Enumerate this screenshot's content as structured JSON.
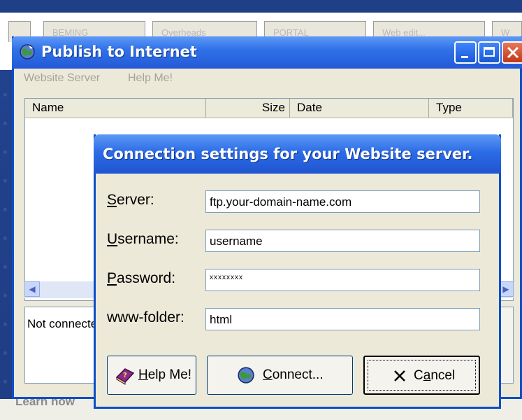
{
  "background": {
    "tabs": [
      "BEMING",
      "Overheads",
      "PORTAL",
      "Web edit...",
      "W"
    ],
    "bottom_text": "Learn how"
  },
  "window": {
    "title": "Publish to Internet",
    "menu": [
      "Website Server",
      "Help Me!"
    ],
    "columns": [
      "Name",
      "Size",
      "Date",
      "Type"
    ],
    "status": "Not connected"
  },
  "dialog": {
    "title": "Connection settings for your Website server.",
    "fields": [
      {
        "label_u": "S",
        "label_rest": "erver:",
        "value": "ftp.your-domain-name.com"
      },
      {
        "label_u": "U",
        "label_rest": "sername:",
        "value": "username"
      },
      {
        "label_u": "P",
        "label_rest": "assword:",
        "value": "xxxxxxxx"
      },
      {
        "label_u": "",
        "label_rest": "www-folder:",
        "value": "html"
      }
    ],
    "buttons": {
      "help_u": "H",
      "help_rest": "elp Me!",
      "connect_u": "C",
      "connect_rest": "onnect...",
      "cancel_pre": "C",
      "cancel_u": "a",
      "cancel_rest": "ncel"
    }
  },
  "colors": {
    "title_blue": "#2b6ce6",
    "face": "#ece9d8",
    "close_red": "#c4361a"
  }
}
